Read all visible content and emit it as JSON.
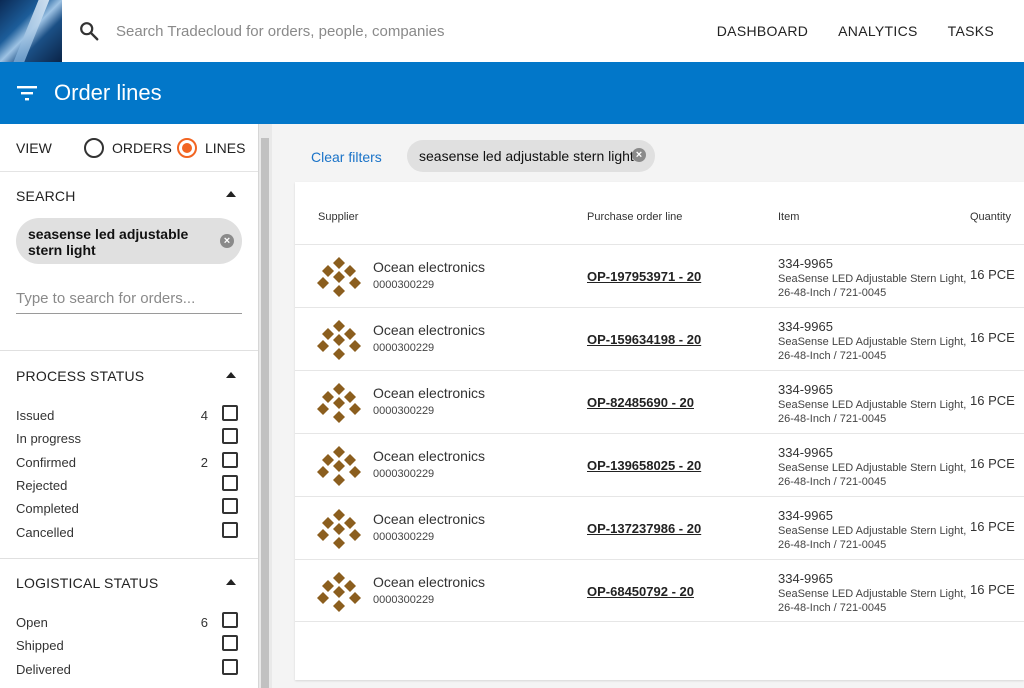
{
  "topbar": {
    "search_placeholder": "Search Tradecloud for orders, people, companies",
    "nav": [
      "DASHBOARD",
      "ANALYTICS",
      "TASKS"
    ]
  },
  "titlebar": {
    "title": "Order lines"
  },
  "sidebar": {
    "view": {
      "label": "VIEW",
      "options": [
        "ORDERS",
        "LINES"
      ],
      "selected": "LINES"
    },
    "search": {
      "heading": "SEARCH",
      "chip": "seasense led adjustable stern light",
      "placeholder": "Type to search for orders..."
    },
    "process_status": {
      "heading": "PROCESS STATUS",
      "items": [
        {
          "label": "Issued",
          "count": "4"
        },
        {
          "label": "In progress",
          "count": ""
        },
        {
          "label": "Confirmed",
          "count": "2"
        },
        {
          "label": "Rejected",
          "count": ""
        },
        {
          "label": "Completed",
          "count": ""
        },
        {
          "label": "Cancelled",
          "count": ""
        }
      ]
    },
    "logistical_status": {
      "heading": "LOGISTICAL STATUS",
      "items": [
        {
          "label": "Open",
          "count": "6"
        },
        {
          "label": "Shipped",
          "count": ""
        },
        {
          "label": "Delivered",
          "count": ""
        }
      ]
    }
  },
  "main": {
    "clear_filters": "Clear filters",
    "chip": "seasense led adjustable stern light",
    "columns": [
      "Supplier",
      "Purchase order line",
      "Item",
      "Quantity"
    ],
    "rows": [
      {
        "supplier": "Ocean electronics",
        "code": "0000300229",
        "po": "OP-197953971 - 20",
        "item": "334-9965",
        "desc": "SeaSense LED Adjustable Stern Light, 26-48-Inch / 721-0045",
        "qty": "16 PCE"
      },
      {
        "supplier": "Ocean electronics",
        "code": "0000300229",
        "po": "OP-159634198 - 20",
        "item": "334-9965",
        "desc": "SeaSense LED Adjustable Stern Light, 26-48-Inch / 721-0045",
        "qty": "16 PCE"
      },
      {
        "supplier": "Ocean electronics",
        "code": "0000300229",
        "po": "OP-82485690 - 20",
        "item": "334-9965",
        "desc": "SeaSense LED Adjustable Stern Light, 26-48-Inch / 721-0045",
        "qty": "16 PCE"
      },
      {
        "supplier": "Ocean electronics",
        "code": "0000300229",
        "po": "OP-139658025 - 20",
        "item": "334-9965",
        "desc": "SeaSense LED Adjustable Stern Light, 26-48-Inch / 721-0045",
        "qty": "16 PCE"
      },
      {
        "supplier": "Ocean electronics",
        "code": "0000300229",
        "po": "OP-137237986 - 20",
        "item": "334-9965",
        "desc": "SeaSense LED Adjustable Stern Light, 26-48-Inch / 721-0045",
        "qty": "16 PCE"
      },
      {
        "supplier": "Ocean electronics",
        "code": "0000300229",
        "po": "OP-68450792 - 20",
        "item": "334-9965",
        "desc": "SeaSense LED Adjustable Stern Light, 26-48-Inch / 721-0045",
        "qty": "16 PCE"
      }
    ]
  },
  "colors": {
    "primary": "#0277c9",
    "accent": "#f26522",
    "link": "#1a73c8",
    "supplier_logo": "#8b5e1e"
  }
}
